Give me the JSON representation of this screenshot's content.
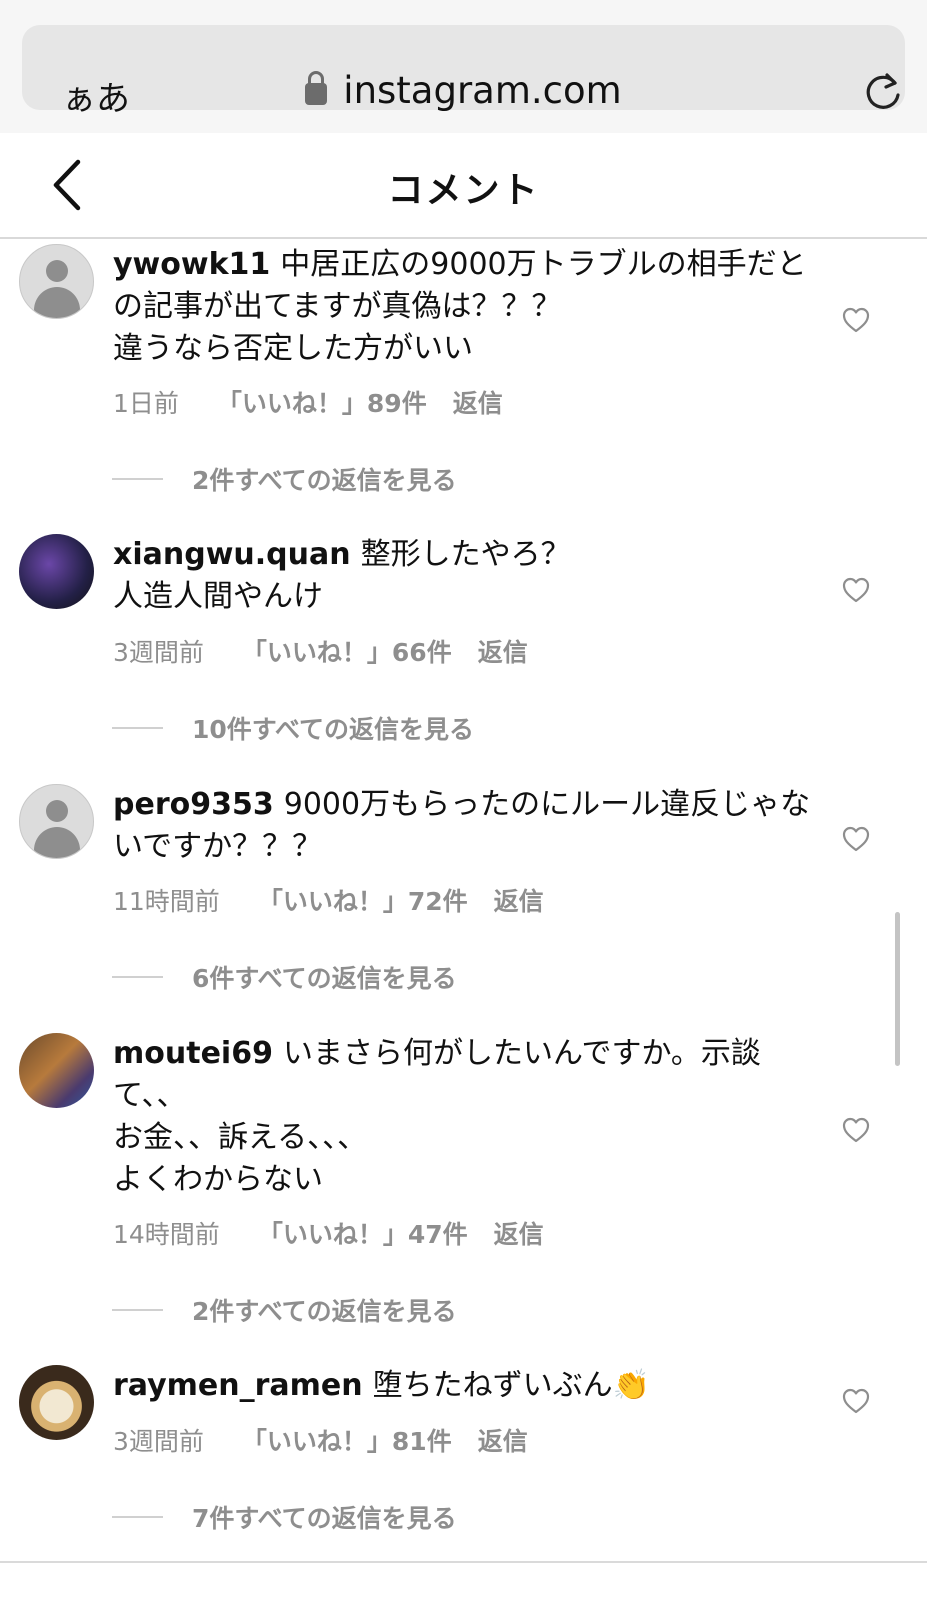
{
  "browser": {
    "text_size_label": "ぁあ",
    "url": "instagram.com"
  },
  "header": {
    "title": "コメント"
  },
  "comments": [
    {
      "username": "ywowk11",
      "text": "中居正広の9000万トラブルの相手だとの記事が出てますが真偽は？？？\n違うなら否定した方がいい",
      "time": "1日前",
      "likes": "「いいね！」89件",
      "reply": "返信",
      "view_replies": "2件すべての返信を見る"
    },
    {
      "username": "xiangwu.quan",
      "text": "整形したやろ？\n人造人間やんけ",
      "time": "3週間前",
      "likes": "「いいね！」66件",
      "reply": "返信",
      "view_replies": "10件すべての返信を見る"
    },
    {
      "username": "pero9353",
      "text": "9000万もらったのにルール違反じゃないですか？？？",
      "time": "11時間前",
      "likes": "「いいね！」72件",
      "reply": "返信",
      "view_replies": "6件すべての返信を見る"
    },
    {
      "username": "moutei69",
      "text": "いまさら何がしたいんですか。示談て、、\nお金、、訴える、、、\nよくわからない",
      "time": "14時間前",
      "likes": "「いいね！」47件",
      "reply": "返信",
      "view_replies": "2件すべての返信を見る"
    },
    {
      "username": "raymen_ramen",
      "text": "堕ちたねずいぶん👏",
      "time": "3週間前",
      "likes": "「いいね！」81件",
      "reply": "返信",
      "view_replies": "7件すべての返信を見る"
    }
  ]
}
